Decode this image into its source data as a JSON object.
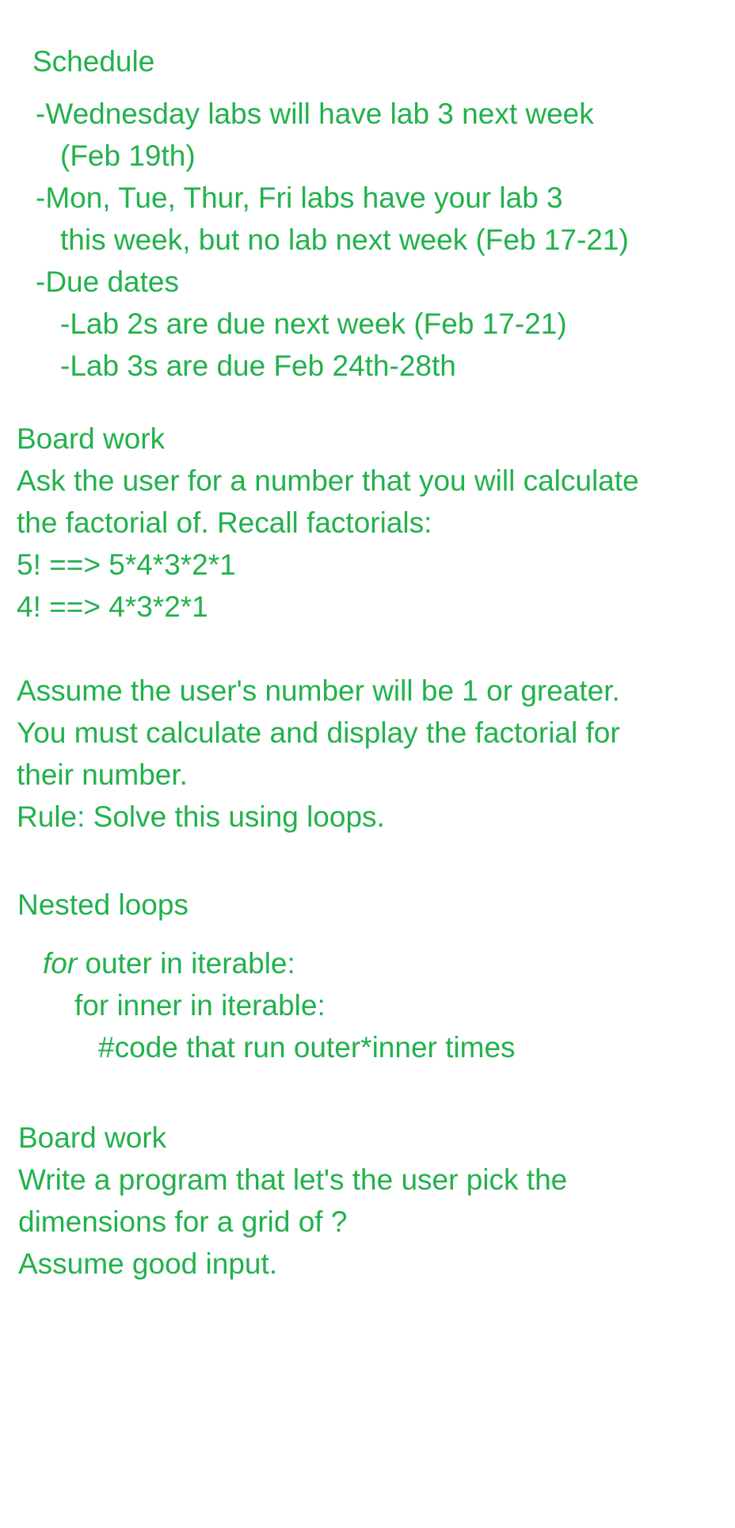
{
  "schedule": {
    "heading": "Schedule",
    "lines": [
      "-Wednesday labs will have lab 3 next week",
      "(Feb 19th)",
      "-Mon, Tue, Thur, Fri labs have your lab 3",
      "this week, but no lab next week (Feb 17-21)",
      "-Due dates",
      "-Lab 2s are due next week (Feb 17-21)",
      "-Lab 3s are due Feb 24th-28th"
    ]
  },
  "board_work_1": {
    "heading": "Board work",
    "lines": [
      "Ask the user for a number that you will calculate",
      "the factorial of. Recall factorials:",
      "5! ==> 5*4*3*2*1",
      "4! ==> 4*3*2*1",
      "Assume the user's number will be 1 or greater.",
      "You must calculate and display the factorial for",
      "their number.",
      "Rule: Solve this using loops."
    ]
  },
  "nested_loops": {
    "heading": "Nested loops",
    "code": {
      "keyword": "for",
      "outer_rest": " outer in iterable:",
      "inner": "for inner in iterable:",
      "comment": "#code that run outer*inner times"
    }
  },
  "board_work_2": {
    "heading": "Board work",
    "lines": [
      "Write a program that let's the user pick the",
      "dimensions for a grid of ?",
      "Assume good input."
    ]
  },
  "colors": {
    "ink": "#22b14c",
    "background": "#ffffff"
  }
}
